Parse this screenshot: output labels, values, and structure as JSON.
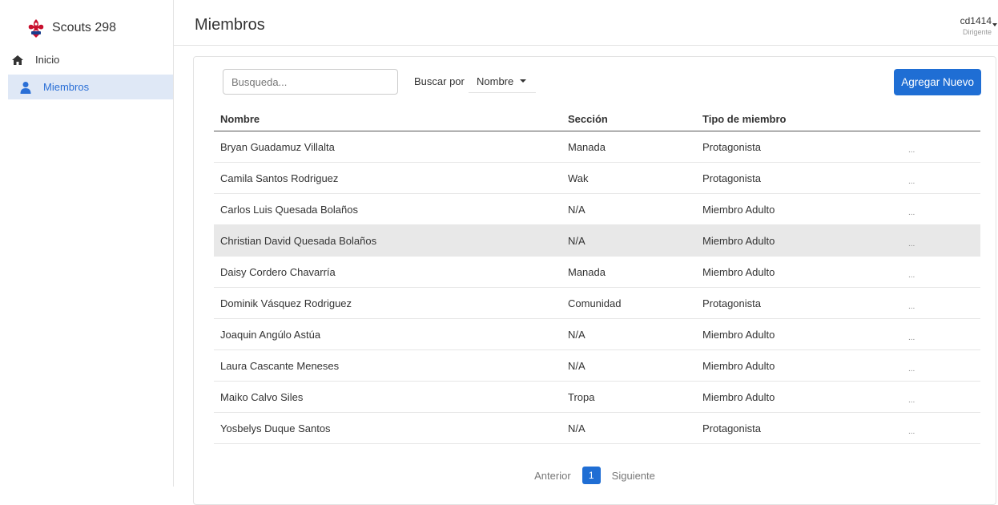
{
  "sidebar": {
    "brand_name": "Scouts 298",
    "items": [
      {
        "label": "Inicio",
        "icon": "home-icon"
      },
      {
        "label": "Miembros",
        "icon": "person-icon",
        "active": true
      }
    ]
  },
  "header": {
    "title": "Miembros",
    "user_name": "cd1414",
    "user_role": "Dirigente"
  },
  "toolbar": {
    "search_placeholder": "Busqueda...",
    "search_value": "",
    "search_by_label": "Buscar por",
    "search_by_selected": "Nombre",
    "add_label": "Agregar Nuevo"
  },
  "table": {
    "headers": [
      "Nombre",
      "Sección",
      "Tipo de miembro"
    ],
    "action_label": "...",
    "rows": [
      [
        "Bryan Guadamuz Villalta",
        "Manada",
        "Protagonista"
      ],
      [
        "Camila Santos Rodriguez",
        "Wak",
        "Protagonista"
      ],
      [
        "Carlos Luis Quesada Bolaños",
        "N/A",
        "Miembro Adulto"
      ],
      [
        "Christian David Quesada Bolaños",
        "N/A",
        "Miembro Adulto"
      ],
      [
        "Daisy Cordero Chavarría",
        "Manada",
        "Miembro Adulto"
      ],
      [
        "Dominik Vásquez Rodriguez",
        "Comunidad",
        "Protagonista"
      ],
      [
        "Joaquin Angúlo Astúa",
        "N/A",
        "Miembro Adulto"
      ],
      [
        "Laura Cascante Meneses",
        "N/A",
        "Miembro Adulto"
      ],
      [
        "Maiko Calvo Siles",
        "Tropa",
        "Miembro Adulto"
      ],
      [
        "Yosbelys Duque Santos",
        "N/A",
        "Protagonista"
      ]
    ]
  },
  "pagination": {
    "prev_label": "Anterior",
    "current_page": "1",
    "next_label": "Siguiente"
  },
  "colors": {
    "accent": "#1f6ed4",
    "active_nav_bg": "#dfe8f6",
    "active_nav_text": "#2a6fd6"
  }
}
